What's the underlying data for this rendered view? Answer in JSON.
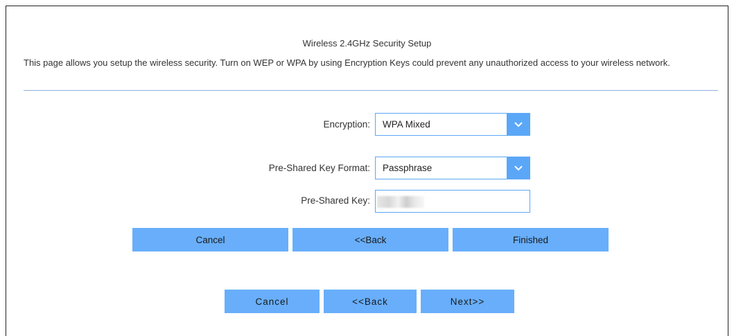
{
  "page": {
    "title": "Wireless 2.4GHz Security Setup",
    "description": "This page allows you setup the wireless security. Turn on WEP or WPA by using Encryption Keys could prevent any unauthorized access to your wireless network."
  },
  "form": {
    "encryption": {
      "label": "Encryption:",
      "value": "WPA Mixed"
    },
    "key_format": {
      "label": "Pre-Shared Key Format:",
      "value": "Passphrase"
    },
    "psk": {
      "label": "Pre-Shared Key:",
      "value": ""
    }
  },
  "buttons_primary": {
    "cancel": "Cancel",
    "back": "<<Back",
    "finished": "Finished"
  },
  "buttons_secondary": {
    "cancel": "Cancel",
    "back": "<<Back",
    "next": "Next>>"
  },
  "icons": {
    "select_arrow": "chevron-down-icon"
  },
  "colors": {
    "accent": "#68aefb",
    "border": "#5ba7f7",
    "divider": "#8fb0e0"
  }
}
